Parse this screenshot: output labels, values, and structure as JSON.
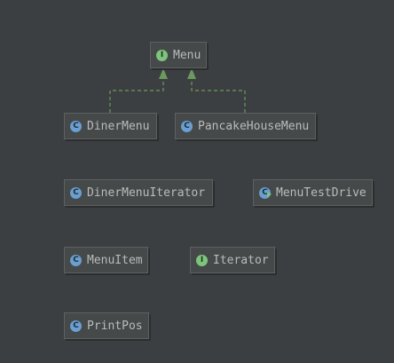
{
  "diagram": {
    "background": "#3c3f41",
    "nodes": [
      {
        "id": "menu",
        "label": "Menu",
        "kind": "interface"
      },
      {
        "id": "diner-menu",
        "label": "DinerMenu",
        "kind": "class"
      },
      {
        "id": "pancake-house-menu",
        "label": "PancakeHouseMenu",
        "kind": "class"
      },
      {
        "id": "diner-menu-iterator",
        "label": "DinerMenuIterator",
        "kind": "class"
      },
      {
        "id": "menu-test-drive",
        "label": "MenuTestDrive",
        "kind": "class-main"
      },
      {
        "id": "menu-item",
        "label": "MenuItem",
        "kind": "class"
      },
      {
        "id": "iterator",
        "label": "Iterator",
        "kind": "interface"
      },
      {
        "id": "print-pos",
        "label": "PrintPos",
        "kind": "class"
      }
    ],
    "edges": [
      {
        "from": "diner-menu",
        "to": "menu",
        "type": "implements"
      },
      {
        "from": "pancake-house-menu",
        "to": "menu",
        "type": "implements"
      }
    ],
    "badge_letters": {
      "class": "C",
      "interface": "I"
    },
    "colors": {
      "node_fill": "#45494a",
      "node_border": "#5e6060",
      "text": "#bbbbbb",
      "class_badge": "#6a9fcf",
      "interface_badge": "#7fc47d",
      "edge": "#6b9a5e"
    }
  }
}
